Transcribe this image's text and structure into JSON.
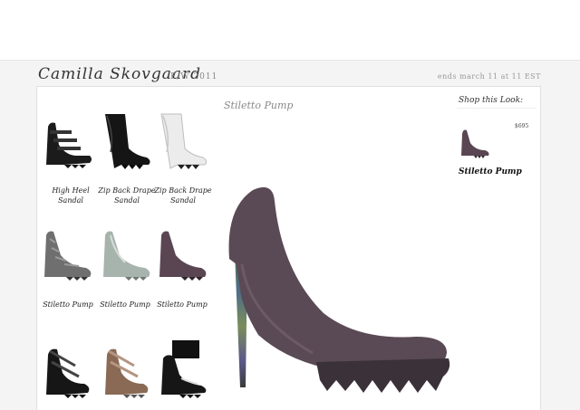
{
  "header": {
    "brand": "Camilla Skovgaard",
    "season": "F/W 2011",
    "ends_notice": "ends march 11 at 11 EST"
  },
  "grid": {
    "items": [
      {
        "label": "High Heel Sandal",
        "icon": "black-strappy-sandal-icon"
      },
      {
        "label": "Zip Back Drape Sandal",
        "icon": "black-drape-bootie-icon"
      },
      {
        "label": "Zip Back Drape Sandal",
        "icon": "white-drape-bootie-icon"
      },
      {
        "label": "Stiletto Pump",
        "icon": "grey-python-pump-icon"
      },
      {
        "label": "Stiletto Pump",
        "icon": "silver-pump-icon"
      },
      {
        "label": "Stiletto Pump",
        "icon": "plum-pump-icon"
      },
      {
        "label": "",
        "icon": "black-cage-sandal-icon"
      },
      {
        "label": "",
        "icon": "tan-cage-sandal-icon"
      },
      {
        "label": "",
        "icon": "black-cuff-sandal-icon"
      }
    ]
  },
  "hero": {
    "title": "Stiletto Pump",
    "icon": "hero-suede-pump-icon"
  },
  "shop": {
    "title": "Shop this Look:",
    "price": "$695",
    "item_name": "Stiletto Pump",
    "icon": "shop-pump-thumbnail-icon"
  },
  "colors": {
    "page_bg": "#f4f4f4",
    "panel_bg": "#ffffff",
    "suede": "#5a4a55",
    "sole": "#3a3238"
  }
}
